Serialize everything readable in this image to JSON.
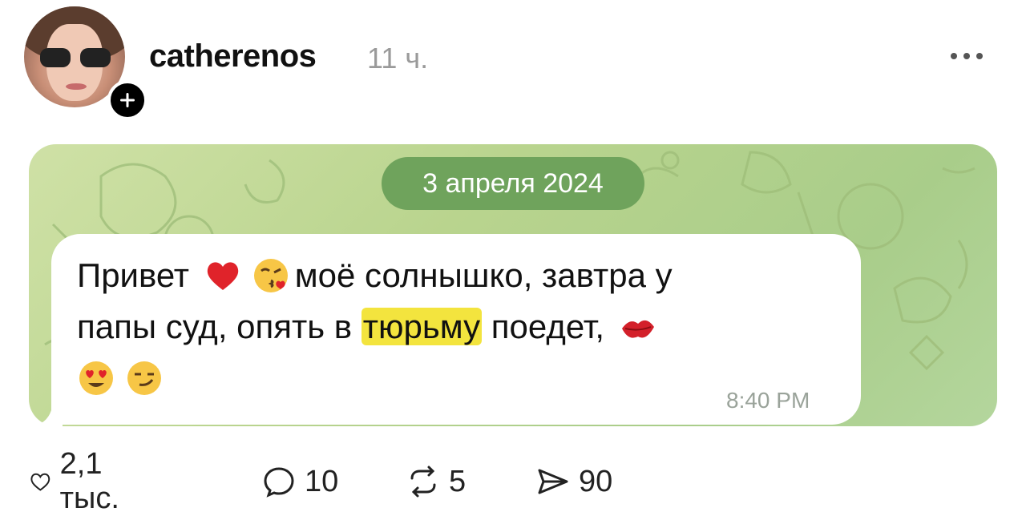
{
  "post": {
    "username": "catherenos",
    "time": "11 ч."
  },
  "media": {
    "date_label": "3 апреля 2024",
    "message": {
      "part1": "Привет",
      "part2": "моё солнышко, завтра у",
      "part3": "папы суд, опять в",
      "highlight": "тюрьму",
      "part4": "поедет,",
      "time": "8:40 PM"
    }
  },
  "actions": {
    "likes": "2,1 тыс.",
    "comments": "10",
    "reposts": "5",
    "shares": "90"
  },
  "colors": {
    "date_pill": "#6fa35c",
    "highlight": "#f3e43e",
    "background_green": "#b9d48e"
  }
}
